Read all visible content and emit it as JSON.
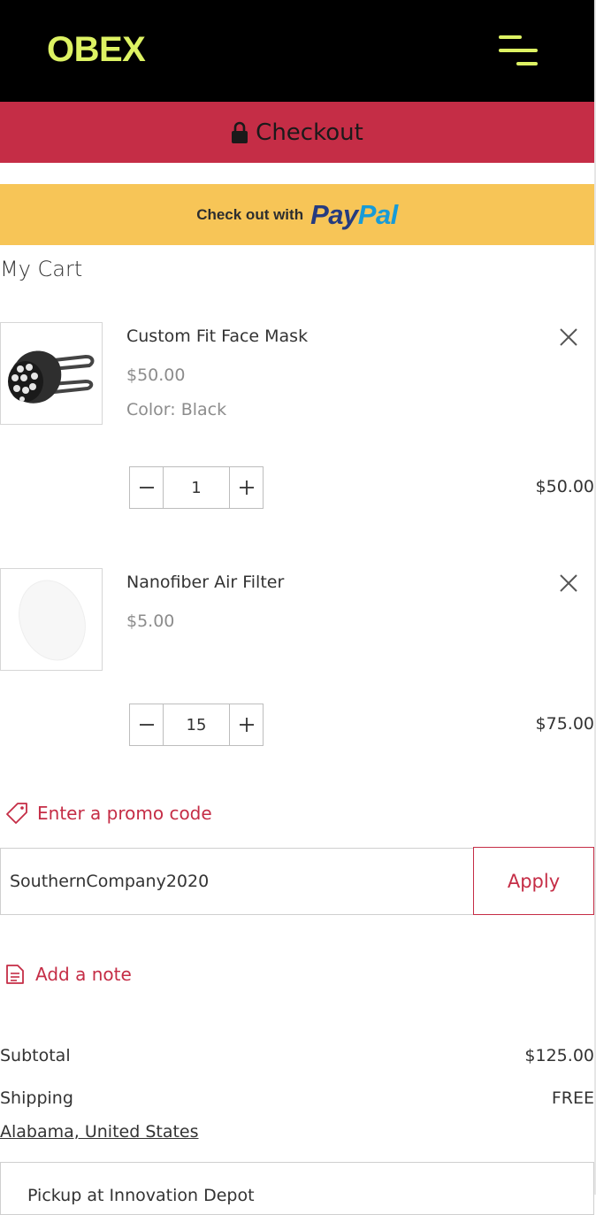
{
  "header": {
    "logo": "OBEX",
    "menu_icon": "hamburger-menu-icon"
  },
  "checkout": {
    "label": "Checkout",
    "icon": "lock-icon",
    "color": "#c52d46"
  },
  "paypal": {
    "prefix": "Check out with",
    "brand_pay": "Pay",
    "brand_pal": "Pal",
    "color": "#f7c557"
  },
  "cart": {
    "title": "My Cart",
    "items": [
      {
        "name": "Custom Fit Face Mask",
        "price": "$50.00",
        "color": "Color: Black",
        "quantity": "1",
        "line_total": "$50.00"
      },
      {
        "name": "Nanofiber Air Filter",
        "price": "$5.00",
        "quantity": "15",
        "line_total": "$75.00"
      }
    ]
  },
  "promo": {
    "link_label": "Enter a promo code",
    "input_value": "SouthernCompany2020",
    "apply_label": "Apply"
  },
  "note": {
    "label": "Add a note"
  },
  "summary": {
    "subtotal_label": "Subtotal",
    "subtotal_value": "$125.00",
    "shipping_label": "Shipping",
    "shipping_value": "FREE",
    "region": "Alabama, United States"
  },
  "pickup": {
    "label": "Pickup at Innovation Depot"
  },
  "accent_color": "#c52d46",
  "logo_color": "#ddf263"
}
